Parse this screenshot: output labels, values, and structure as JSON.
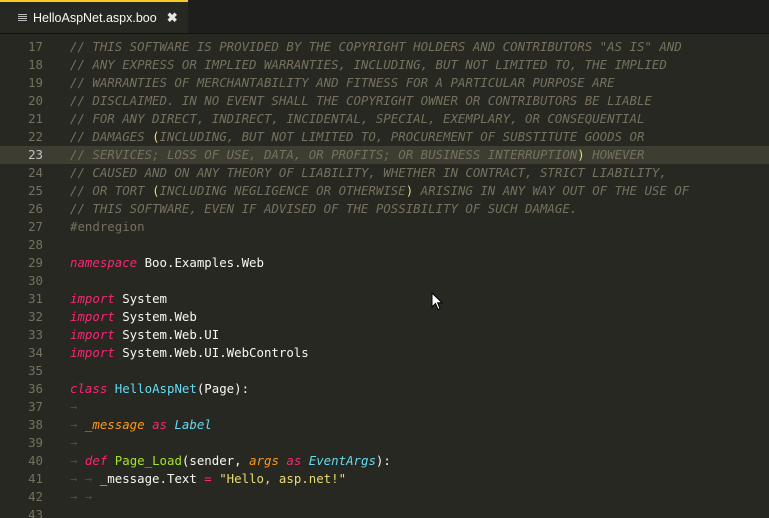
{
  "tab": {
    "title": "HelloAspNet.aspx.boo",
    "close": "✖"
  },
  "lines": [
    {
      "n": "17",
      "parts": [
        [
          "c",
          "// THIS SOFTWARE IS PROVIDED BY THE COPYRIGHT HOLDERS AND CONTRIBUTORS \"AS IS\" AND"
        ]
      ]
    },
    {
      "n": "18",
      "parts": [
        [
          "c",
          "// ANY EXPRESS OR IMPLIED WARRANTIES, INCLUDING, BUT NOT LIMITED TO, THE IMPLIED"
        ]
      ]
    },
    {
      "n": "19",
      "parts": [
        [
          "c",
          "// WARRANTIES OF MERCHANTABILITY AND FITNESS FOR A PARTICULAR PURPOSE ARE"
        ]
      ]
    },
    {
      "n": "20",
      "parts": [
        [
          "c",
          "// DISCLAIMED. IN NO EVENT SHALL THE COPYRIGHT OWNER OR CONTRIBUTORS BE LIABLE"
        ]
      ]
    },
    {
      "n": "21",
      "parts": [
        [
          "c",
          "// FOR ANY DIRECT, INDIRECT, INCIDENTAL, SPECIAL, EXEMPLARY, OR CONSEQUENTIAL"
        ]
      ]
    },
    {
      "n": "22",
      "parts": [
        [
          "c",
          "// DAMAGES "
        ],
        [
          "pb",
          "("
        ],
        [
          "c",
          "INCLUDING, BUT NOT LIMITED TO, PROCUREMENT OF SUBSTITUTE GOODS OR"
        ]
      ]
    },
    {
      "n": "23",
      "hl": true,
      "parts": [
        [
          "c",
          "// SERVICES; LOSS OF USE, DATA, OR PROFITS; OR BUSINESS INTERRUPTION"
        ],
        [
          "pb",
          ")"
        ],
        [
          "c",
          " HOWEVER"
        ]
      ]
    },
    {
      "n": "24",
      "parts": [
        [
          "c",
          "// CAUSED AND ON ANY THEORY OF LIABILITY, WHETHER IN CONTRACT, STRICT LIABILITY,"
        ]
      ]
    },
    {
      "n": "25",
      "parts": [
        [
          "c",
          "// OR TORT "
        ],
        [
          "pb",
          "("
        ],
        [
          "c",
          "INCLUDING NEGLIGENCE OR OTHERWISE"
        ],
        [
          "pb",
          ")"
        ],
        [
          "c",
          " ARISING IN ANY WAY OUT OF THE USE OF"
        ]
      ]
    },
    {
      "n": "26",
      "parts": [
        [
          "c",
          "// THIS SOFTWARE, EVEN IF ADVISED OF THE POSSIBILITY OF SUCH DAMAGE."
        ]
      ]
    },
    {
      "n": "27",
      "parts": [
        [
          "dir",
          "#endregion"
        ]
      ]
    },
    {
      "n": "28",
      "parts": []
    },
    {
      "n": "29",
      "parts": [
        [
          "kw",
          "namespace"
        ],
        [
          "",
          " Boo.Examples.Web"
        ]
      ]
    },
    {
      "n": "30",
      "parts": []
    },
    {
      "n": "31",
      "parts": [
        [
          "kw",
          "import"
        ],
        [
          "",
          " System"
        ]
      ]
    },
    {
      "n": "32",
      "parts": [
        [
          "kw",
          "import"
        ],
        [
          "",
          " System.Web"
        ]
      ]
    },
    {
      "n": "33",
      "parts": [
        [
          "kw",
          "import"
        ],
        [
          "",
          " System.Web.UI"
        ]
      ]
    },
    {
      "n": "34",
      "parts": [
        [
          "kw",
          "import"
        ],
        [
          "",
          " System.Web.UI.WebControls"
        ]
      ]
    },
    {
      "n": "35",
      "parts": []
    },
    {
      "n": "36",
      "parts": [
        [
          "kw",
          "class"
        ],
        [
          "",
          " "
        ],
        [
          "cls",
          "HelloAspNet"
        ],
        [
          "",
          "(Page):"
        ]
      ]
    },
    {
      "n": "37",
      "parts": [
        [
          "ws",
          "→"
        ]
      ]
    },
    {
      "n": "38",
      "parts": [
        [
          "ws",
          "→ "
        ],
        [
          "var",
          "_message"
        ],
        [
          "",
          " "
        ],
        [
          "kw",
          "as"
        ],
        [
          "",
          " "
        ],
        [
          "ty",
          "Label"
        ]
      ]
    },
    {
      "n": "39",
      "parts": [
        [
          "ws",
          "→"
        ]
      ]
    },
    {
      "n": "40",
      "parts": [
        [
          "ws",
          "→ "
        ],
        [
          "kw",
          "def"
        ],
        [
          "",
          " "
        ],
        [
          "fn",
          "Page_Load"
        ],
        [
          "",
          "(sender, "
        ],
        [
          "arg",
          "args"
        ],
        [
          "",
          " "
        ],
        [
          "kw",
          "as"
        ],
        [
          "",
          " "
        ],
        [
          "ty",
          "EventArgs"
        ],
        [
          "",
          "):"
        ]
      ]
    },
    {
      "n": "41",
      "parts": [
        [
          "ws",
          "→ → "
        ],
        [
          "",
          "_message.Text "
        ],
        [
          "op",
          "="
        ],
        [
          "",
          " "
        ],
        [
          "str",
          "\"Hello, asp.net!\""
        ]
      ]
    },
    {
      "n": "42",
      "parts": [
        [
          "ws",
          "→ →"
        ]
      ]
    },
    {
      "n": "43",
      "parts": []
    }
  ],
  "colors": {
    "background": "#272822",
    "comment": "#75715e",
    "keyword": "#f92672",
    "class": "#66d9ef",
    "function": "#a6e22e",
    "string": "#e6db74",
    "tab_accent": "#f9ca24"
  }
}
